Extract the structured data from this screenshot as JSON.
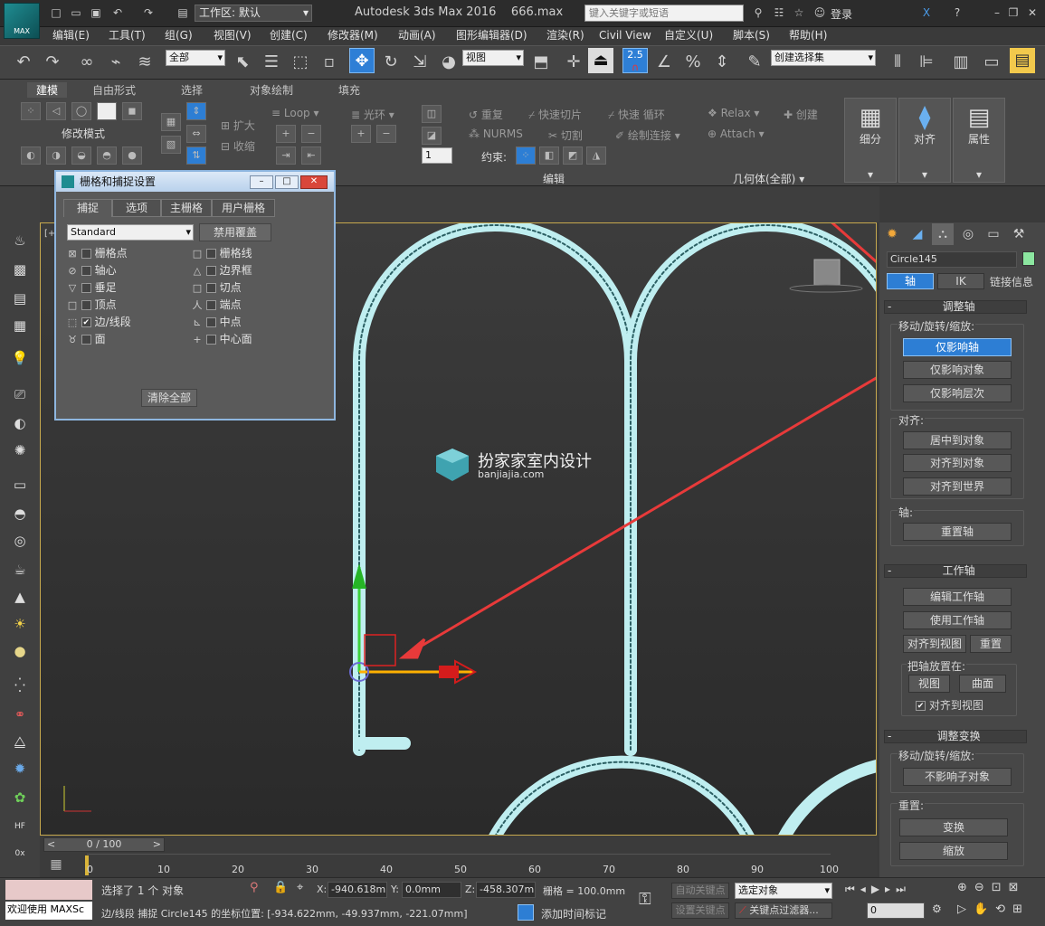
{
  "titlebar": {
    "logo": "MAX",
    "workspace": "工作区: 默认",
    "title": "Autodesk 3ds Max 2016",
    "file": "666.max",
    "search_placeholder": "键入关键字或短语",
    "login": "登录"
  },
  "menus": [
    "编辑(E)",
    "工具(T)",
    "组(G)",
    "视图(V)",
    "创建(C)",
    "修改器(M)",
    "动画(A)",
    "图形编辑器(D)",
    "渲染(R)",
    "Civil View",
    "自定义(U)",
    "脚本(S)",
    "帮助(H)"
  ],
  "toolbar": {
    "filter": "全部",
    "refcoord": "视图",
    "snap_label": "2.5",
    "selset": "创建选择集"
  },
  "ribbon": {
    "tabs": [
      "建模",
      "自由形式",
      "选择",
      "对象绘制",
      "填充"
    ],
    "modify_mode": "修改模式",
    "expand": "扩大",
    "shrink": "收缩",
    "loop": "Loop",
    "ring": "光环",
    "repeat": "重复",
    "quickslice": "快速切片",
    "quickloop": "快速 循环",
    "nurms": "NURMS",
    "cut": "切割",
    "paintconnect": "绘制连接",
    "constraint": "约束:",
    "count": "1",
    "edit": "编辑",
    "geometry": "几何体(全部)",
    "relax": "Relax",
    "create": "创建",
    "attach": "Attach",
    "subdivide": "细分",
    "align": "对齐",
    "properties": "属性"
  },
  "dialog": {
    "title": "栅格和捕捉设置",
    "tabs": [
      "捕捉",
      "选项",
      "主栅格",
      "用户栅格"
    ],
    "preset": "Standard",
    "override": "禁用覆盖",
    "left": [
      {
        "label": "栅格点",
        "checked": false
      },
      {
        "label": "轴心",
        "checked": false
      },
      {
        "label": "垂足",
        "checked": false
      },
      {
        "label": "顶点",
        "checked": false
      },
      {
        "label": "边/线段",
        "checked": true
      },
      {
        "label": "面",
        "checked": false
      }
    ],
    "right": [
      {
        "label": "栅格线",
        "checked": false
      },
      {
        "label": "边界框",
        "checked": false
      },
      {
        "label": "切点",
        "checked": false
      },
      {
        "label": "端点",
        "checked": false
      },
      {
        "label": "中点",
        "checked": false
      },
      {
        "label": "中心面",
        "checked": false
      }
    ],
    "clear_all": "清除全部"
  },
  "viewport": {
    "label": "[+]",
    "watermark_cn": "扮家家室内设计",
    "watermark_url": "banjiajia.com"
  },
  "panel": {
    "object_name": "Circle145",
    "tab_pivot": "轴",
    "tab_ik": "IK",
    "tab_link": "链接信息",
    "adjust_pivot": "调整轴",
    "move_rot_scale": "移动/旋转/缩放:",
    "affect_pivot": "仅影响轴",
    "affect_object": "仅影响对象",
    "affect_hierarchy": "仅影响层次",
    "alignment": "对齐:",
    "center_to_object": "居中到对象",
    "align_to_object": "对齐到对象",
    "align_to_world": "对齐到世界",
    "pivot": "轴:",
    "reset_pivot": "重置轴",
    "working_pivot": "工作轴",
    "edit_wp": "编辑工作轴",
    "use_wp": "使用工作轴",
    "align_to_view": "对齐到视图",
    "reset": "重置",
    "place_pivot": "把轴放置在:",
    "view": "视图",
    "surface": "曲面",
    "align_view_check": "对齐到视图",
    "adjust_transform": "调整变换",
    "mrs2": "移动/旋转/缩放:",
    "dont_affect_children": "不影响子对象",
    "reset2": "重置:",
    "transform": "变换",
    "scale": "缩放"
  },
  "timeline": {
    "counter": "0 / 100",
    "ticks": [
      "0",
      "10",
      "20",
      "30",
      "40",
      "50",
      "60",
      "70",
      "80",
      "90",
      "100"
    ]
  },
  "status": {
    "welcome": "欢迎使用 MAXSc",
    "selected": "选择了 1 个 对象",
    "prompt": "边/线段 捕捉 Circle145 的坐标位置: [-934.622mm, -49.937mm, -221.07mm]",
    "x": "-940.618m",
    "y": "0.0mm",
    "z": "-458.307m",
    "grid": "栅格 = 100.0mm",
    "autokey": "自动关键点",
    "setkey": "设置关键点",
    "selobj": "选定对象",
    "keyfilters": "关键点过滤器...",
    "addtime": "添加时间标记",
    "frame": "0"
  }
}
